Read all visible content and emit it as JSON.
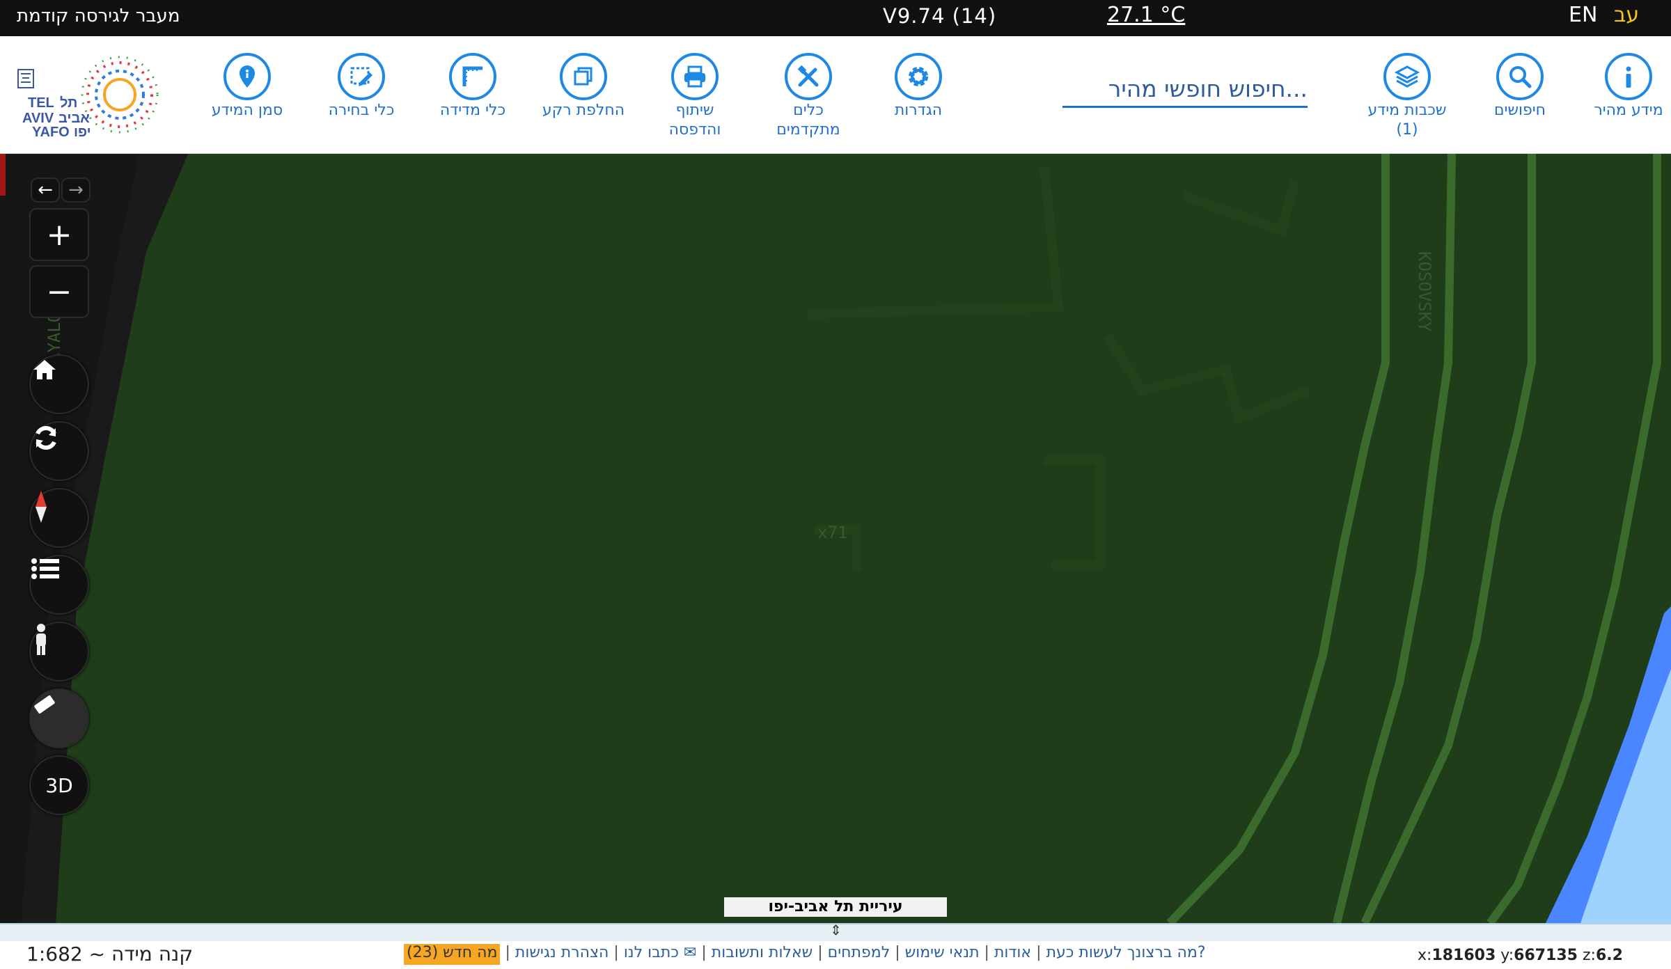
{
  "topbar": {
    "previous_version": "מעבר לגירסה קודמת",
    "version": "V9.74 (14)",
    "temperature": "27.1 °C",
    "lang_en": "EN",
    "lang_he": "עב"
  },
  "toolbar": {
    "tools": [
      {
        "id": "quick-info",
        "label": "מידע מהיר",
        "icon": "info-icon"
      },
      {
        "id": "searches",
        "label": "חיפושים",
        "icon": "search-icon"
      },
      {
        "id": "layers",
        "label": "שכבות מידע",
        "label2": "(1)",
        "icon": "layers-icon"
      },
      {
        "id": "settings",
        "label": "הגדרות",
        "icon": "gear-icon"
      },
      {
        "id": "advanced",
        "label": "כלים",
        "label2": "מתקדמים",
        "icon": "tools-icon"
      },
      {
        "id": "share",
        "label": "שיתוף",
        "label2": "והדפסה",
        "icon": "printer-icon"
      },
      {
        "id": "basemap",
        "label": "החלפת רקע",
        "icon": "basemap-icon"
      },
      {
        "id": "measure",
        "label": "כלי מדידה",
        "icon": "ruler-icon"
      },
      {
        "id": "select",
        "label": "כלי בחירה",
        "icon": "select-icon"
      },
      {
        "id": "marker",
        "label": "סמן המידע",
        "icon": "marker-icon"
      }
    ],
    "search_placeholder": "חיפוש חופשי מהיר..."
  },
  "logo": {
    "he_line1": "תל",
    "he_line2": "אביב",
    "he_line3": "יפו",
    "en_line1": "TEL",
    "en_line2": "AVIV",
    "en_line3": "YAFO"
  },
  "map": {
    "street_labels": [
      "KOSOVSKY",
      "AYALON",
      "x71"
    ],
    "caption": "עיריית תל אביב-יפו",
    "controls": {
      "three_d": "3D"
    },
    "colors": {
      "ground": "#1f3d19",
      "track": "#3a6b2c",
      "water": "#4a86ff",
      "water_light": "#9fd3ff"
    }
  },
  "bottom": {
    "scale": "קנה מידה ~ 1:682",
    "coords": {
      "x": "181603",
      "y": "667135",
      "z": "6.2"
    },
    "links": [
      "מה ברצונך לעשות כעת?",
      "אודות",
      "תנאי שימוש",
      "למפתחים",
      "שאלות ותשובות",
      "כתבו לנו ✉",
      "הצהרת נגישות",
      "מה חדש (23)"
    ]
  }
}
